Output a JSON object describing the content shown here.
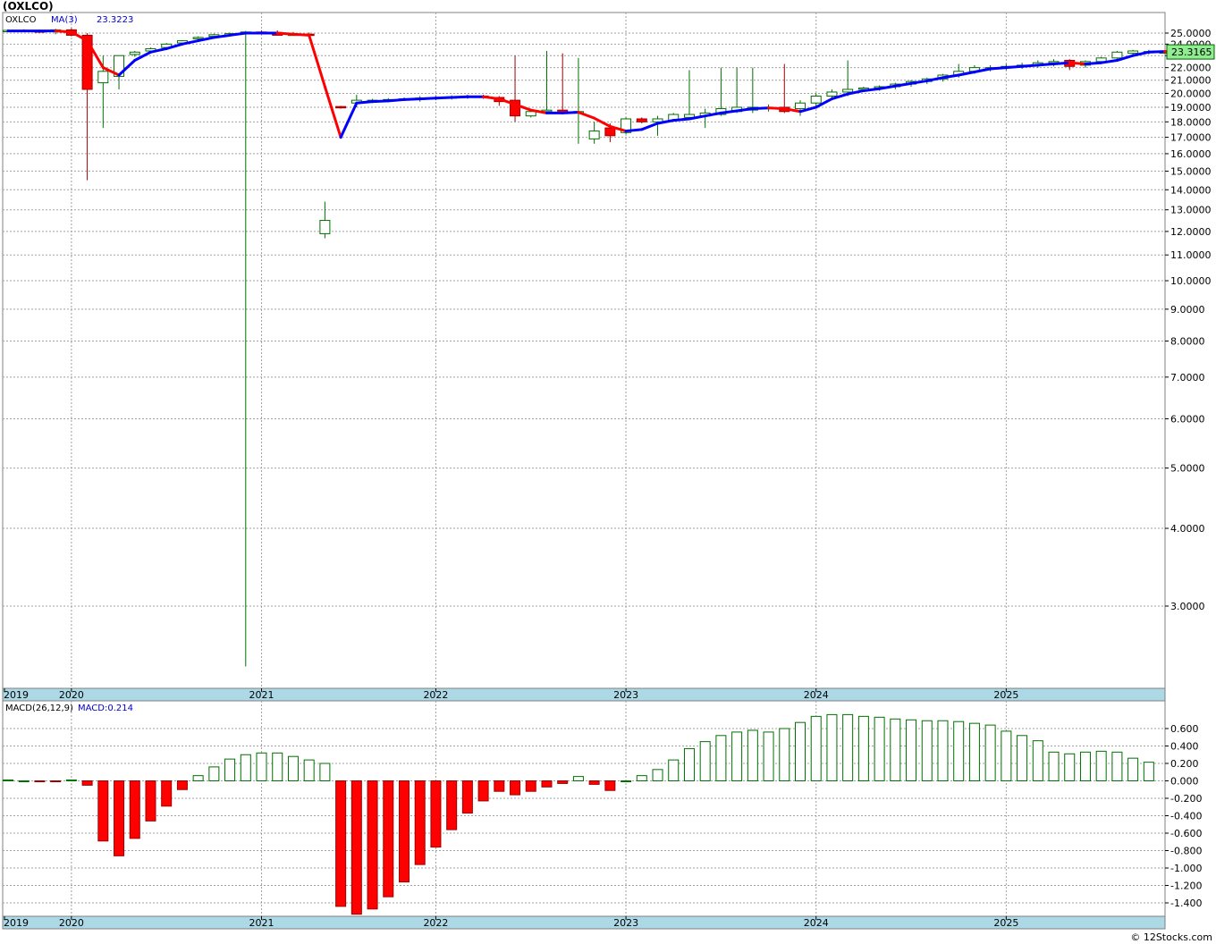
{
  "title": "(OXLCO)",
  "watermark": "© 12Stocks.com",
  "colors": {
    "up": "#007000",
    "down": "#ff0000",
    "ma": "#0000ff",
    "axis_band": "#add8e6",
    "grid": "#a0a0a0",
    "last_bg": "#90ee90"
  },
  "price_panel": {
    "legend": {
      "symbol": "OXLCO",
      "ma_label": "MA(3)",
      "ma_value": "23.3223"
    },
    "last_price_label": "23.3165",
    "scale": "log",
    "y_ticks": [
      "25.0000",
      "24.0000",
      "23.0000",
      "22.0000",
      "21.0000",
      "20.0000",
      "19.0000",
      "18.0000",
      "17.0000",
      "16.0000",
      "15.0000",
      "14.0000",
      "13.0000",
      "12.0000",
      "11.0000",
      "10.0000",
      "9.0000",
      "8.0000",
      "7.0000",
      "6.0000",
      "5.0000",
      "4.0000",
      "3.0000"
    ]
  },
  "macd_panel": {
    "legend": {
      "label": "MACD(26,12,9)",
      "value_label": "MACD:0.214"
    },
    "y_ticks": [
      "0.600",
      "0.400",
      "0.200",
      "0.000",
      "-0.200",
      "-0.400",
      "-0.600",
      "-0.800",
      "-1.000",
      "-1.200",
      "-1.400"
    ]
  },
  "x_axis_labels": [
    "2019",
    "2020",
    "2021",
    "2022",
    "2023",
    "2024",
    "2025"
  ],
  "chart_data": [
    {
      "type": "candlestick",
      "title": "(OXLCO)",
      "interval": "monthly",
      "y_scale": "log",
      "ylim": [
        2.4,
        26.5
      ],
      "grid": true,
      "x_labels": [
        "2019",
        "2020",
        "2021",
        "2022",
        "2023",
        "2024",
        "2025"
      ],
      "candles": [
        {
          "date": "2019-10",
          "open": 25.2,
          "high": 25.35,
          "low": 25.1,
          "close": 25.25
        },
        {
          "date": "2019-11",
          "open": 25.25,
          "high": 25.35,
          "low": 25.15,
          "close": 25.2
        },
        {
          "date": "2019-12",
          "open": 25.2,
          "high": 25.3,
          "low": 25.1,
          "close": 25.15
        },
        {
          "date": "2020-01",
          "open": 25.15,
          "high": 25.4,
          "low": 24.9,
          "close": 25.3
        },
        {
          "date": "2020-02",
          "open": 25.3,
          "high": 25.45,
          "low": 24.7,
          "close": 24.8
        },
        {
          "date": "2020-03",
          "open": 24.8,
          "high": 25.0,
          "low": 14.5,
          "close": 20.3
        },
        {
          "date": "2020-04",
          "open": 20.8,
          "high": 23.0,
          "low": 17.6,
          "close": 21.7
        },
        {
          "date": "2020-05",
          "open": 21.3,
          "high": 23.0,
          "low": 20.3,
          "close": 23.0
        },
        {
          "date": "2020-06",
          "open": 23.1,
          "high": 23.4,
          "low": 22.9,
          "close": 23.3
        },
        {
          "date": "2020-07",
          "open": 23.4,
          "high": 23.7,
          "low": 23.3,
          "close": 23.6
        },
        {
          "date": "2020-08",
          "open": 23.7,
          "high": 24.1,
          "low": 23.6,
          "close": 24.0
        },
        {
          "date": "2020-09",
          "open": 24.1,
          "high": 24.35,
          "low": 24.0,
          "close": 24.3
        },
        {
          "date": "2020-10",
          "open": 24.5,
          "high": 24.7,
          "low": 24.4,
          "close": 24.6
        },
        {
          "date": "2020-11",
          "open": 24.7,
          "high": 24.95,
          "low": 24.6,
          "close": 24.85
        },
        {
          "date": "2020-12",
          "open": 24.85,
          "high": 25.05,
          "low": 24.7,
          "close": 24.95
        },
        {
          "date": "2021-01",
          "open": 24.95,
          "high": 25.2,
          "low": 2.4,
          "close": 25.1
        },
        {
          "date": "2021-02",
          "open": 25.1,
          "high": 25.25,
          "low": 24.9,
          "close": 25.0
        },
        {
          "date": "2021-03",
          "open": 25.05,
          "high": 25.25,
          "low": 24.9,
          "close": 24.8
        },
        {
          "date": "2021-04",
          "open": 24.9,
          "high": 25.1,
          "low": 24.8,
          "close": 24.9
        },
        {
          "date": "2021-05",
          "open": 24.9,
          "high": 25.05,
          "low": 24.7,
          "close": 24.85
        },
        {
          "date": "2021-06",
          "open": 11.9,
          "high": 13.4,
          "low": 11.7,
          "close": 12.5
        },
        {
          "date": "2021-07",
          "open": 19.05,
          "high": 19.1,
          "low": 18.9,
          "close": 19.0
        },
        {
          "date": "2021-08",
          "open": 19.3,
          "high": 19.9,
          "low": 19.0,
          "close": 19.5
        },
        {
          "date": "2021-09",
          "open": 19.45,
          "high": 19.6,
          "low": 19.3,
          "close": 19.5
        },
        {
          "date": "2021-10",
          "open": 19.5,
          "high": 19.65,
          "low": 19.4,
          "close": 19.55
        },
        {
          "date": "2021-11",
          "open": 19.55,
          "high": 19.7,
          "low": 19.45,
          "close": 19.6
        },
        {
          "date": "2021-12",
          "open": 19.6,
          "high": 19.8,
          "low": 19.4,
          "close": 19.65
        },
        {
          "date": "2022-01",
          "open": 19.65,
          "high": 19.8,
          "low": 19.5,
          "close": 19.7
        },
        {
          "date": "2022-02",
          "open": 19.7,
          "high": 19.85,
          "low": 19.55,
          "close": 19.75
        },
        {
          "date": "2022-03",
          "open": 19.75,
          "high": 19.9,
          "low": 19.6,
          "close": 19.8
        },
        {
          "date": "2022-04",
          "open": 19.8,
          "high": 19.9,
          "low": 19.6,
          "close": 19.7
        },
        {
          "date": "2022-05",
          "open": 19.7,
          "high": 19.8,
          "low": 19.1,
          "close": 19.4
        },
        {
          "date": "2022-06",
          "open": 19.5,
          "high": 23.0,
          "low": 18.0,
          "close": 18.4
        },
        {
          "date": "2022-07",
          "open": 18.4,
          "high": 18.8,
          "low": 18.3,
          "close": 18.7
        },
        {
          "date": "2022-08",
          "open": 18.7,
          "high": 23.4,
          "low": 18.5,
          "close": 18.8
        },
        {
          "date": "2022-09",
          "open": 18.8,
          "high": 23.2,
          "low": 18.5,
          "close": 18.6
        },
        {
          "date": "2022-10",
          "open": 18.6,
          "high": 22.8,
          "low": 16.6,
          "close": 18.7
        },
        {
          "date": "2022-11",
          "open": 16.9,
          "high": 18.0,
          "low": 16.6,
          "close": 17.4
        },
        {
          "date": "2022-12",
          "open": 17.6,
          "high": 17.9,
          "low": 16.7,
          "close": 17.1
        },
        {
          "date": "2023-01",
          "open": 17.3,
          "high": 18.3,
          "low": 17.2,
          "close": 18.2
        },
        {
          "date": "2023-02",
          "open": 18.2,
          "high": 18.3,
          "low": 17.9,
          "close": 18.0
        },
        {
          "date": "2023-03",
          "open": 18.0,
          "high": 18.4,
          "low": 17.1,
          "close": 18.2
        },
        {
          "date": "2023-04",
          "open": 18.1,
          "high": 18.6,
          "low": 18.0,
          "close": 18.5
        },
        {
          "date": "2023-05",
          "open": 18.3,
          "high": 21.8,
          "low": 18.2,
          "close": 18.5
        },
        {
          "date": "2023-06",
          "open": 18.4,
          "high": 18.9,
          "low": 17.6,
          "close": 18.6
        },
        {
          "date": "2023-07",
          "open": 18.5,
          "high": 22.0,
          "low": 18.4,
          "close": 18.9
        },
        {
          "date": "2023-08",
          "open": 18.7,
          "high": 22.0,
          "low": 18.6,
          "close": 19.0
        },
        {
          "date": "2023-09",
          "open": 18.8,
          "high": 22.0,
          "low": 18.6,
          "close": 19.0
        },
        {
          "date": "2023-10",
          "open": 18.9,
          "high": 19.2,
          "low": 18.7,
          "close": 19.0
        },
        {
          "date": "2023-11",
          "open": 19.0,
          "high": 22.3,
          "low": 18.6,
          "close": 18.7
        },
        {
          "date": "2023-12",
          "open": 18.9,
          "high": 19.5,
          "low": 18.4,
          "close": 19.3
        },
        {
          "date": "2024-01",
          "open": 19.3,
          "high": 20.0,
          "low": 19.0,
          "close": 19.8
        },
        {
          "date": "2024-02",
          "open": 19.8,
          "high": 20.3,
          "low": 19.6,
          "close": 20.1
        },
        {
          "date": "2024-03",
          "open": 20.1,
          "high": 22.6,
          "low": 19.8,
          "close": 20.3
        },
        {
          "date": "2024-04",
          "open": 20.3,
          "high": 20.5,
          "low": 20.1,
          "close": 20.4
        },
        {
          "date": "2024-05",
          "open": 20.4,
          "high": 20.6,
          "low": 20.2,
          "close": 20.5
        },
        {
          "date": "2024-06",
          "open": 20.5,
          "high": 20.8,
          "low": 20.3,
          "close": 20.7
        },
        {
          "date": "2024-07",
          "open": 20.7,
          "high": 21.0,
          "low": 20.5,
          "close": 20.9
        },
        {
          "date": "2024-08",
          "open": 20.9,
          "high": 21.2,
          "low": 20.7,
          "close": 21.1
        },
        {
          "date": "2024-09",
          "open": 21.1,
          "high": 21.5,
          "low": 20.9,
          "close": 21.4
        },
        {
          "date": "2024-10",
          "open": 21.4,
          "high": 22.3,
          "low": 21.2,
          "close": 21.7
        },
        {
          "date": "2024-11",
          "open": 21.7,
          "high": 22.2,
          "low": 21.5,
          "close": 22.0
        },
        {
          "date": "2024-12",
          "open": 21.9,
          "high": 22.2,
          "low": 21.7,
          "close": 22.0
        },
        {
          "date": "2025-01",
          "open": 22.0,
          "high": 22.3,
          "low": 21.8,
          "close": 22.1
        },
        {
          "date": "2025-02",
          "open": 22.1,
          "high": 22.4,
          "low": 21.9,
          "close": 22.2
        },
        {
          "date": "2025-03",
          "open": 22.2,
          "high": 22.6,
          "low": 22.0,
          "close": 22.4
        },
        {
          "date": "2025-04",
          "open": 22.4,
          "high": 22.7,
          "low": 22.1,
          "close": 22.5
        },
        {
          "date": "2025-05",
          "open": 22.6,
          "high": 22.7,
          "low": 21.8,
          "close": 22.1
        },
        {
          "date": "2025-06",
          "open": 22.2,
          "high": 22.6,
          "low": 22.0,
          "close": 22.5
        },
        {
          "date": "2025-07",
          "open": 22.5,
          "high": 22.9,
          "low": 22.3,
          "close": 22.8
        },
        {
          "date": "2025-08",
          "open": 22.8,
          "high": 23.4,
          "low": 22.7,
          "close": 23.3
        },
        {
          "date": "2025-09",
          "open": 23.2,
          "high": 23.5,
          "low": 23.0,
          "close": 23.4
        },
        {
          "date": "2025-10",
          "open": 23.3,
          "high": 23.5,
          "low": 23.1,
          "close": 23.35
        },
        {
          "date": "2025-11",
          "open": 23.3,
          "high": 23.45,
          "low": 23.2,
          "close": 23.3165
        }
      ],
      "series": [
        {
          "name": "MA(3)",
          "values": [
            25.2,
            25.2,
            25.2,
            25.2,
            25.1,
            24.3,
            22.0,
            21.4,
            22.6,
            23.3,
            23.6,
            24.0,
            24.3,
            24.6,
            24.8,
            25.0,
            25.0,
            25.0,
            24.9,
            24.8,
            20.5,
            17.0,
            19.3,
            19.4,
            19.45,
            19.55,
            19.6,
            19.65,
            19.7,
            19.75,
            19.75,
            19.6,
            19.2,
            18.8,
            18.6,
            18.6,
            18.65,
            18.25,
            17.7,
            17.4,
            17.5,
            17.9,
            18.1,
            18.2,
            18.4,
            18.6,
            18.75,
            18.9,
            18.95,
            18.9,
            18.7,
            19.0,
            19.6,
            19.95,
            20.2,
            20.35,
            20.55,
            20.75,
            20.95,
            21.2,
            21.4,
            21.65,
            21.9,
            22.0,
            22.1,
            22.2,
            22.3,
            22.4,
            22.3,
            22.4,
            22.6,
            23.0,
            23.3,
            23.35,
            23.3223
          ]
        }
      ]
    },
    {
      "type": "bar",
      "title": "MACD(26,12,9)",
      "ylim": [
        -1.5,
        0.8
      ],
      "grid": true,
      "x_labels": [
        "2019",
        "2020",
        "2021",
        "2022",
        "2023",
        "2024",
        "2025"
      ],
      "values": [
        0.01,
        0.0,
        -0.01,
        -0.01,
        0.01,
        -0.05,
        -0.69,
        -0.86,
        -0.66,
        -0.46,
        -0.29,
        -0.1,
        0.06,
        0.16,
        0.25,
        0.3,
        0.32,
        0.32,
        0.28,
        0.24,
        0.2,
        -1.44,
        -1.53,
        -1.47,
        -1.33,
        -1.16,
        -0.96,
        -0.76,
        -0.56,
        -0.37,
        -0.23,
        -0.12,
        -0.16,
        -0.12,
        -0.07,
        -0.03,
        0.05,
        -0.04,
        -0.11,
        0.0,
        0.06,
        0.13,
        0.24,
        0.37,
        0.45,
        0.52,
        0.56,
        0.58,
        0.56,
        0.6,
        0.67,
        0.74,
        0.76,
        0.76,
        0.74,
        0.73,
        0.71,
        0.7,
        0.69,
        0.69,
        0.68,
        0.66,
        0.64,
        0.57,
        0.52,
        0.46,
        0.33,
        0.31,
        0.33,
        0.34,
        0.33,
        0.26,
        0.214
      ]
    }
  ]
}
